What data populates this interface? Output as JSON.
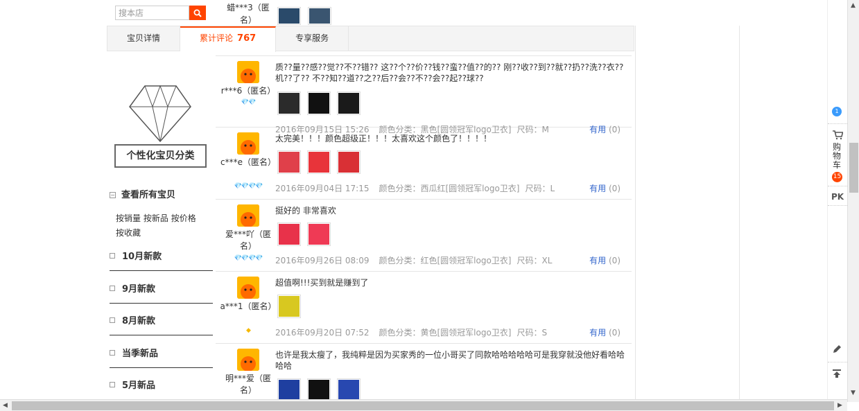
{
  "search": {
    "placeholder": "搜本店"
  },
  "tabs": [
    {
      "label": "宝贝详情"
    },
    {
      "label": "累计评论",
      "count": "767"
    },
    {
      "label": "专享服务"
    }
  ],
  "sidebar_left": {
    "category_title": "个性化宝贝分类",
    "all_items": "查看所有宝贝",
    "sort_links": [
      "按销量",
      "按新品",
      "按价格",
      "按收藏"
    ],
    "categories": [
      "10月新款",
      "9月新款",
      "8月新款",
      "当季新品",
      "5月新品"
    ]
  },
  "top_partial": {
    "user": "蜡***3（匿名）"
  },
  "reviews": [
    {
      "user": "r***6（匿名）",
      "rank": "💎💎",
      "text": "质??量??感??觉??不??错?? 这??个??价??钱??蛮??值??的?? 刚??收??到??就??扔??洗??衣??机??了?? 不??知??道??之??后??会??不??会??起??球??",
      "date": "2016年09月15日 15:26",
      "sku": "颜色分类：黑色[圆领冠军logo卫衣]",
      "size": "尺码：M",
      "useful": "有用",
      "useful_count": "(0)",
      "thumbs": [
        "#2b2b2b",
        "#111",
        "#1a1a1a"
      ]
    },
    {
      "user": "c***e（匿名）",
      "rank": "💎💎💎💎",
      "text": "太完美！！！颜色超级正！！！太喜欢这个颜色了！！！！",
      "date": "2016年09月04日 17:15",
      "sku": "颜色分类：西瓜红[圆领冠军logo卫衣]",
      "size": "尺码：L",
      "useful": "有用",
      "useful_count": "(0)",
      "thumbs": [
        "#e0404a",
        "#e8343a",
        "#d93035"
      ]
    },
    {
      "user": "爱***吖（匿名）",
      "rank": "💎💎💎💎",
      "text": "挺好的 非常喜欢",
      "date": "2016年09月26日 08:09",
      "sku": "颜色分类：红色[圆领冠军logo卫衣]",
      "size": "尺码：XL",
      "useful": "有用",
      "useful_count": "(0)",
      "thumbs": [
        "#e8324a",
        "#ef3a55"
      ]
    },
    {
      "user": "a***1（匿名）",
      "rank": "◆",
      "text": "超值啊!!!买到就是赚到了",
      "date": "2016年09月20日 07:52",
      "sku": "颜色分类：黄色[圆领冠军logo卫衣]",
      "size": "尺码：S",
      "useful": "有用",
      "useful_count": "(0)",
      "thumbs": [
        "#d8c820"
      ]
    },
    {
      "user": "明***爱（匿名）",
      "rank": "",
      "text": "也许是我太瘦了，我纯粹是因为买家秀的一位小哥买了同款哈哈哈哈哈可是我穿就没他好看哈哈哈哈",
      "date": "",
      "sku": "",
      "size": "",
      "useful": "",
      "useful_count": "",
      "thumbs": [
        "#1f3fa0",
        "#111",
        "#2848b0"
      ]
    }
  ],
  "right_toolbar": {
    "cart_label": "购物车",
    "cart_count": "15",
    "pk_label": "PK",
    "badge": "1"
  }
}
